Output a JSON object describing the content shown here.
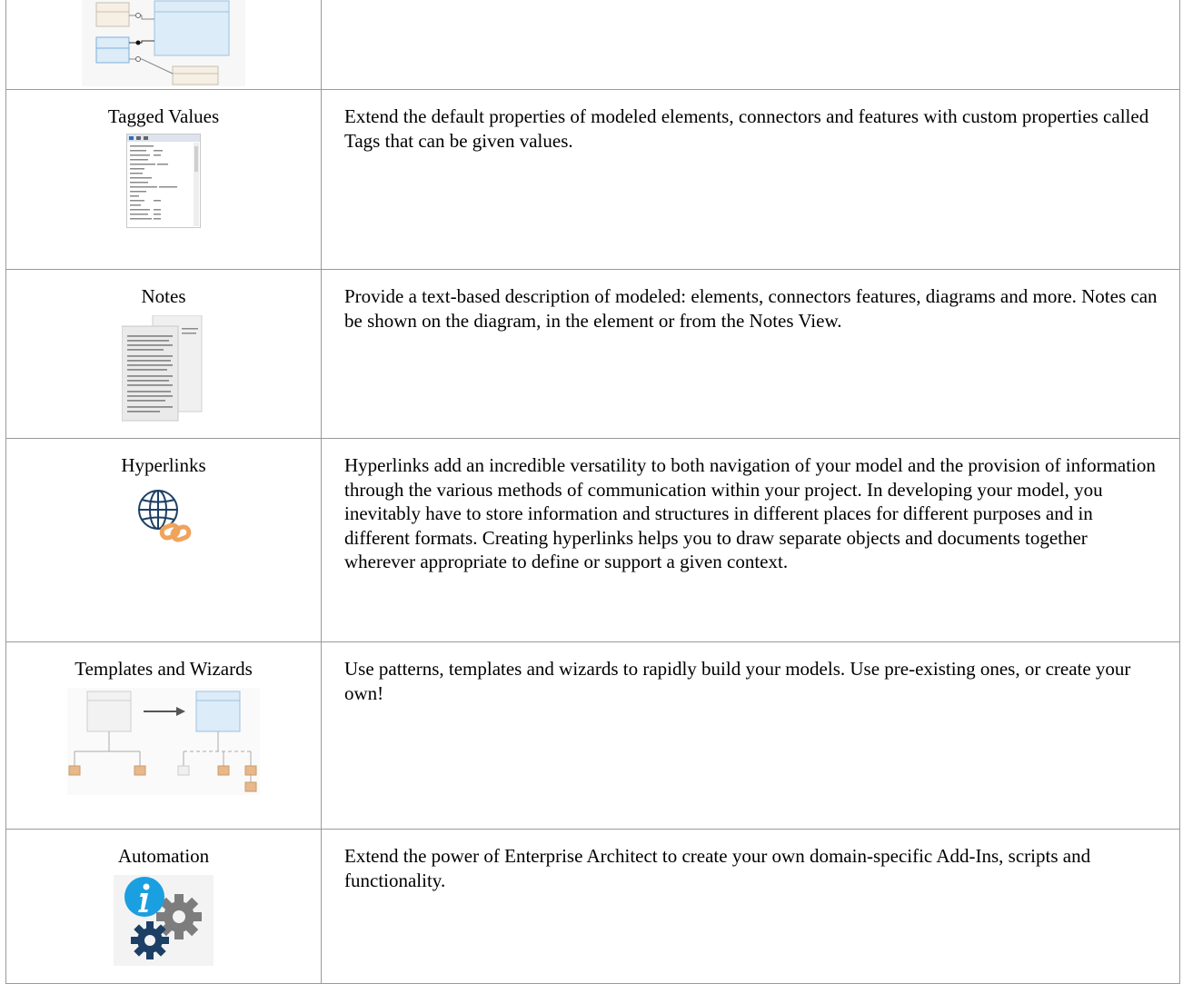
{
  "rows": [
    {
      "title": "",
      "description": "",
      "image": "class-diagram-icon"
    },
    {
      "title": "Tagged Values",
      "description": "Extend the default properties of modeled elements, connectors and features with custom properties called Tags that can be given values.",
      "image": "tagged-values-window-icon"
    },
    {
      "title": "Notes",
      "description": "Provide a text-based description of modeled: elements, connectors features, diagrams and more. Notes can be shown on the diagram, in the element or from the Notes View.",
      "image": "notes-pages-icon"
    },
    {
      "title": "Hyperlinks",
      "description": "Hyperlinks add an incredible versatility to both navigation of your model and the provision of information through the various methods of communication within your project. In developing your model, you inevitably have to store information and structures in different places for different purposes and in different formats. Creating hyperlinks helps you to draw separate objects and documents together wherever appropriate to define or support a given context.",
      "image": "globe-link-icon"
    },
    {
      "title": "Templates and Wizards",
      "description": "Use patterns, templates and wizards to rapidly build your models. Use pre-existing ones, or create your own!",
      "image": "template-transform-icon"
    },
    {
      "title": "Automation",
      "description": "Extend the power of Enterprise Architect to create your own domain-specific Add-Ins, scripts and functionality.",
      "image": "info-gears-icon"
    }
  ],
  "colors": {
    "border": "#9a9a9a",
    "diagram_blue": "#dcecf8",
    "diagram_beige": "#f5efe4",
    "folder_orange": "#e8b88a",
    "info_blue": "#1a9fe0",
    "gear_navy": "#1c3f66",
    "gear_grey": "#7d7d7d",
    "link_orange": "#f0a35a"
  }
}
